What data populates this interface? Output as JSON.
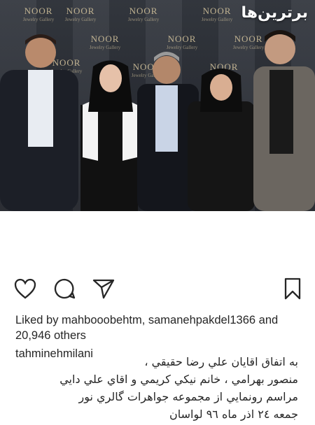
{
  "photo": {
    "backdrop_logo_text": "NOOR",
    "backdrop_logo_subtext": "Jewelry Gallery",
    "watermark": "برترین‌ها"
  },
  "actions": {
    "like_icon": "heart-icon",
    "comment_icon": "comment-icon",
    "share_icon": "send-icon",
    "save_icon": "bookmark-icon"
  },
  "likes": {
    "text": "Liked by mahbooobehtm, samanehpakdel1366 and 20,946 others"
  },
  "caption": {
    "username": "tahminehmilani",
    "lines": [
      "به اتفاق اقايان علي رضا حقيقي ،",
      "منصور بهرامي ، خانم نيكي كريمي و اقاي علي دايي",
      "مراسم رونمايي از مجموعه جواهرات گالري  نور",
      "جمعه ٢٤ اذر ماه ٩٦ لواسان"
    ]
  }
}
